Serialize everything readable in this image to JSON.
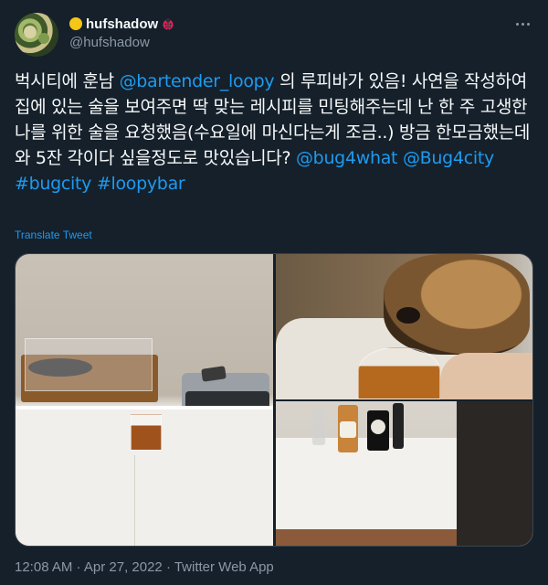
{
  "author": {
    "display_name": "hufshadow",
    "handle": "@hufshadow",
    "status_emoji": "yellow-circle-icon",
    "badge_emoji": "ladybug-icon"
  },
  "tweet": {
    "segments": [
      {
        "type": "text",
        "value": "벅시티에 훈남 "
      },
      {
        "type": "mention",
        "value": "@bartender_loopy"
      },
      {
        "type": "text",
        "value": " 의 루피바가 있음! 사연을 작성하여 집에 있는 술을 보여주면 딱 맞는 레시피를 민팅해주는데 난 한 주 고생한 나를 위한 술을 요청했음(수요일에 마신다는게 조금..) 방금 한모금했는데 와 5잔 각이다 싶을정도로 맛있습니다? "
      },
      {
        "type": "mention",
        "value": "@bug4what"
      },
      {
        "type": "text",
        "value": " "
      },
      {
        "type": "mention",
        "value": "@Bug4city"
      },
      {
        "type": "text",
        "value": " "
      },
      {
        "type": "hashtag",
        "value": "#bugcity"
      },
      {
        "type": "text",
        "value": " "
      },
      {
        "type": "hashtag",
        "value": "#loopybar"
      }
    ],
    "translate_label": "Translate Tweet",
    "timestamp": "12:08 AM · Apr 27, 2022 · Twitter Web App"
  },
  "media": {
    "photos": [
      {
        "name": "photo-turntable-glass"
      },
      {
        "name": "photo-dog-snifter"
      },
      {
        "name": "photo-bottles-shelf"
      }
    ]
  },
  "colors": {
    "background": "#15202b",
    "accent": "#1d9bf0",
    "text": "#f7f9f9",
    "muted": "#8b98a5"
  }
}
